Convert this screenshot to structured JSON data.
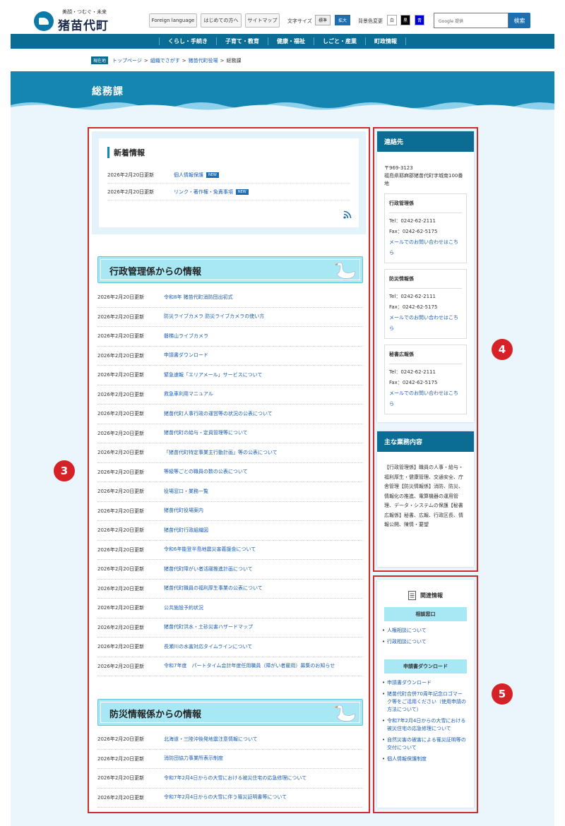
{
  "header": {
    "logo_tagline": "美顔・つむぐ・未来",
    "logo_name": "猪苗代町",
    "btn_foreign": "Foreign language",
    "btn_first": "はじめての方へ",
    "btn_sitemap": "サイトマップ",
    "font_size_label": "文字サイズ",
    "font_std": "標準",
    "font_large": "拡大",
    "bg_color_label": "背景色変更",
    "bg_white": "白",
    "bg_black": "黒",
    "bg_blue": "青",
    "search_placeholder": "Google 提供",
    "search_button": "検索"
  },
  "nav": [
    "くらし・手続き",
    "子育て・教育",
    "健康・福祉",
    "しごと・産業",
    "町政情報"
  ],
  "breadcrumb": {
    "tag": "現在地",
    "items": [
      "トップページ",
      "組織でさがす",
      "猪苗代町役場"
    ],
    "current": "総務課"
  },
  "page_title": "総務課",
  "news": {
    "title": "新着情報",
    "items": [
      {
        "date": "2026年2月20日更新",
        "link": "個人情報保護",
        "badge": "NEW"
      },
      {
        "date": "2026年2月20日更新",
        "link": "リンク・著作権・免責事項",
        "badge": "NEW"
      }
    ]
  },
  "section1": {
    "title": "行政管理係からの情報",
    "items": [
      {
        "date": "2026年2月20日更新",
        "link": "令和8年 猪苗代町消防団出初式"
      },
      {
        "date": "2026年2月20日更新",
        "link": "防災ライブカメラ 防災ライブカメラの使い方"
      },
      {
        "date": "2026年2月20日更新",
        "link": "磐梯山ライブカメラ"
      },
      {
        "date": "2026年2月20日更新",
        "link": "申請書ダウンロード"
      },
      {
        "date": "2026年2月20日更新",
        "link": "緊急速報「エリアメール」サービスについて"
      },
      {
        "date": "2026年2月20日更新",
        "link": "救急車利用マニュアル"
      },
      {
        "date": "2026年2月20日更新",
        "link": "猪苗代町人事行政の運営等の状況の公表について"
      },
      {
        "date": "2026年2月20日更新",
        "link": "猪苗代町の給与・定員管理等について"
      },
      {
        "date": "2026年2月20日更新",
        "link": "「猪苗代町特定事業主行動計画」等の公表について"
      },
      {
        "date": "2026年2月20日更新",
        "link": "等級等ごとの職員の数の公表について"
      },
      {
        "date": "2026年2月20日更新",
        "link": "役場窓口・業務一覧"
      },
      {
        "date": "2026年2月20日更新",
        "link": "猪苗代町役場案内"
      },
      {
        "date": "2026年2月20日更新",
        "link": "猪苗代町行政組織図"
      },
      {
        "date": "2026年2月20日更新",
        "link": "令和6年能登半島地震災害義援金について"
      },
      {
        "date": "2026年2月20日更新",
        "link": "猪苗代町障がい者活躍推進計画について"
      },
      {
        "date": "2026年2月20日更新",
        "link": "猪苗代町職員の福利厚生事業の公表について"
      },
      {
        "date": "2026年2月20日更新",
        "link": "公共施設予約状況"
      },
      {
        "date": "2026年2月20日更新",
        "link": "猪苗代町洪水・土砂災害ハザードマップ"
      },
      {
        "date": "2026年2月20日更新",
        "link": "長瀬川の水害対応タイムラインについて"
      },
      {
        "date": "2026年2月20日更新",
        "link": "令和7年度　パートタイム会計年度任用職員（障がい者雇用）募集のお知らせ"
      }
    ]
  },
  "section2": {
    "title": "防災情報係からの情報",
    "items": [
      {
        "date": "2026年2月20日更新",
        "link": "北海道・三陸沖後発地震注意情報について"
      },
      {
        "date": "2026年2月20日更新",
        "link": "消防団協力事業所表示制度"
      },
      {
        "date": "2026年2月20日更新",
        "link": "令和7年2月4日からの大雪における被災住宅の応急修理について"
      },
      {
        "date": "2026年2月20日更新",
        "link": "令和7年2月4日からの大雪に伴う罹災証明書等について"
      }
    ]
  },
  "contact": {
    "title": "連絡先",
    "postal": "〒969-3123",
    "address": "福島県耶麻郡猪苗代町字城南100番地",
    "depts": [
      {
        "name": "行政管理係",
        "tel": "Tel：0242-62-2111",
        "fax": "Fax：0242-62-5175",
        "mail": "メールでのお問い合わせはこちら"
      },
      {
        "name": "防災情報係",
        "tel": "Tel：0242-62-2111",
        "fax": "Fax：0242-62-5175",
        "mail": "メールでのお問い合わせはこちら"
      },
      {
        "name": "秘書広報係",
        "tel": "Tel：0242-62-2111",
        "fax": "Fax：0242-62-5175",
        "mail": "メールでのお問い合わせはこちら"
      }
    ]
  },
  "duties": {
    "title": "主な業務内容",
    "text": "【行政管理係】職員の人事・給与・福利厚生・健康管理、交通安全、庁舎管理【防災情報係】消防、防災、情報化の推進、電算機器の運用管理、データ・システムの保護【秘書広報係】秘書、広報、行政区長、情報公開、陳情・要望"
  },
  "related": {
    "title": "関連情報",
    "sub1": "相談窓口",
    "list1": [
      "人権相談について",
      "行政相談について"
    ],
    "sub2": "申請書ダウンロード",
    "list2": [
      "申請書ダウンロード",
      "猪苗代町合併70周年記念ロゴマーク等をご活用ください（使用申請の方法について）",
      "令和7年2月4日からの大雪における被災住宅の応急修理について",
      "自然災害の被害による罹災証明等の交付について",
      "個人情報保護制度"
    ]
  },
  "markers": [
    "3",
    "4",
    "5"
  ],
  "colors": {
    "nav": "#0b6c94",
    "banner": "#1486b1",
    "section_head": "#a7e8f4",
    "link": "#1a5db3",
    "marker": "#d42226"
  }
}
